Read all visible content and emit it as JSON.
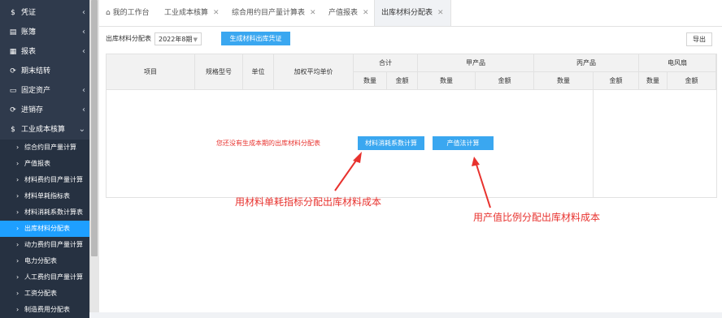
{
  "sidebar": {
    "items": [
      {
        "icon": "$",
        "label": "凭证",
        "chev": "‹"
      },
      {
        "icon": "▤",
        "label": "账簿",
        "chev": "‹"
      },
      {
        "icon": "▦",
        "label": "报表",
        "chev": "‹"
      },
      {
        "icon": "⟳",
        "label": "期末结转",
        "chev": ""
      },
      {
        "icon": "▭",
        "label": "固定资产",
        "chev": "‹"
      },
      {
        "icon": "⟳",
        "label": "进销存",
        "chev": "‹"
      },
      {
        "icon": "$",
        "label": "工业成本核算",
        "chev": "⌄"
      }
    ],
    "sub_items": [
      "综合约目产量计算",
      "产值报表",
      "材料费约目产量计算",
      "材料单耗指标表",
      "材料消耗系数计算表",
      "出库材料分配表",
      "动力费约目产量计算",
      "电力分配表",
      "人工费约目产量计算",
      "工资分配表",
      "制造费用分配表"
    ],
    "active_sub": 5
  },
  "tabs": {
    "home_label": "我的工作台",
    "items": [
      "工业成本核算",
      "综合用约目产量计算表",
      "产值报表",
      "出库材料分配表"
    ]
  },
  "toolbar": {
    "period_label": "出库材料分配表",
    "period_value": "2022年8期",
    "generate_label": "生成材料出库凭证",
    "export_label": "导出"
  },
  "table": {
    "headers": {
      "item": "项目",
      "spec": "规格型号",
      "unit": "单位",
      "avg_price": "加权平均单价",
      "total": "合计",
      "product_a": "甲产品",
      "product_b": "丙产品",
      "fan": "电风扇",
      "qty": "数量",
      "amount": "金额"
    }
  },
  "empty_message": "您还没有生成本期的出库材料分配表",
  "calc_buttons": {
    "coef": "材料消耗系数计算",
    "value": "产值法计算"
  },
  "annotations": {
    "left": "用材料单耗指标分配出库材料成本",
    "right": "用产值比例分配出库材料成本",
    "color": "#e8322e"
  },
  "colors": {
    "accent": "#3aa7f0",
    "active_nav": "#1e9fff",
    "sidebar": "#2f3a4c"
  }
}
